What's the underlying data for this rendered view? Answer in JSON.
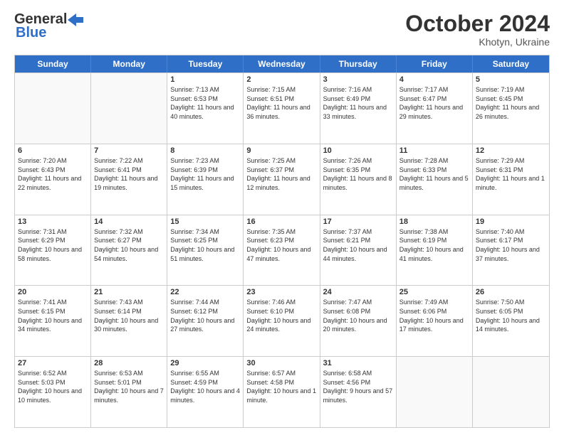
{
  "header": {
    "logo_general": "General",
    "logo_blue": "Blue",
    "month_title": "October 2024",
    "subtitle": "Khotyn, Ukraine"
  },
  "days_of_week": [
    "Sunday",
    "Monday",
    "Tuesday",
    "Wednesday",
    "Thursday",
    "Friday",
    "Saturday"
  ],
  "weeks": [
    [
      {
        "day": "",
        "sunrise": "",
        "sunset": "",
        "daylight": "",
        "empty": true
      },
      {
        "day": "",
        "sunrise": "",
        "sunset": "",
        "daylight": "",
        "empty": true
      },
      {
        "day": "1",
        "sunrise": "Sunrise: 7:13 AM",
        "sunset": "Sunset: 6:53 PM",
        "daylight": "Daylight: 11 hours and 40 minutes.",
        "empty": false
      },
      {
        "day": "2",
        "sunrise": "Sunrise: 7:15 AM",
        "sunset": "Sunset: 6:51 PM",
        "daylight": "Daylight: 11 hours and 36 minutes.",
        "empty": false
      },
      {
        "day": "3",
        "sunrise": "Sunrise: 7:16 AM",
        "sunset": "Sunset: 6:49 PM",
        "daylight": "Daylight: 11 hours and 33 minutes.",
        "empty": false
      },
      {
        "day": "4",
        "sunrise": "Sunrise: 7:17 AM",
        "sunset": "Sunset: 6:47 PM",
        "daylight": "Daylight: 11 hours and 29 minutes.",
        "empty": false
      },
      {
        "day": "5",
        "sunrise": "Sunrise: 7:19 AM",
        "sunset": "Sunset: 6:45 PM",
        "daylight": "Daylight: 11 hours and 26 minutes.",
        "empty": false
      }
    ],
    [
      {
        "day": "6",
        "sunrise": "Sunrise: 7:20 AM",
        "sunset": "Sunset: 6:43 PM",
        "daylight": "Daylight: 11 hours and 22 minutes.",
        "empty": false
      },
      {
        "day": "7",
        "sunrise": "Sunrise: 7:22 AM",
        "sunset": "Sunset: 6:41 PM",
        "daylight": "Daylight: 11 hours and 19 minutes.",
        "empty": false
      },
      {
        "day": "8",
        "sunrise": "Sunrise: 7:23 AM",
        "sunset": "Sunset: 6:39 PM",
        "daylight": "Daylight: 11 hours and 15 minutes.",
        "empty": false
      },
      {
        "day": "9",
        "sunrise": "Sunrise: 7:25 AM",
        "sunset": "Sunset: 6:37 PM",
        "daylight": "Daylight: 11 hours and 12 minutes.",
        "empty": false
      },
      {
        "day": "10",
        "sunrise": "Sunrise: 7:26 AM",
        "sunset": "Sunset: 6:35 PM",
        "daylight": "Daylight: 11 hours and 8 minutes.",
        "empty": false
      },
      {
        "day": "11",
        "sunrise": "Sunrise: 7:28 AM",
        "sunset": "Sunset: 6:33 PM",
        "daylight": "Daylight: 11 hours and 5 minutes.",
        "empty": false
      },
      {
        "day": "12",
        "sunrise": "Sunrise: 7:29 AM",
        "sunset": "Sunset: 6:31 PM",
        "daylight": "Daylight: 11 hours and 1 minute.",
        "empty": false
      }
    ],
    [
      {
        "day": "13",
        "sunrise": "Sunrise: 7:31 AM",
        "sunset": "Sunset: 6:29 PM",
        "daylight": "Daylight: 10 hours and 58 minutes.",
        "empty": false
      },
      {
        "day": "14",
        "sunrise": "Sunrise: 7:32 AM",
        "sunset": "Sunset: 6:27 PM",
        "daylight": "Daylight: 10 hours and 54 minutes.",
        "empty": false
      },
      {
        "day": "15",
        "sunrise": "Sunrise: 7:34 AM",
        "sunset": "Sunset: 6:25 PM",
        "daylight": "Daylight: 10 hours and 51 minutes.",
        "empty": false
      },
      {
        "day": "16",
        "sunrise": "Sunrise: 7:35 AM",
        "sunset": "Sunset: 6:23 PM",
        "daylight": "Daylight: 10 hours and 47 minutes.",
        "empty": false
      },
      {
        "day": "17",
        "sunrise": "Sunrise: 7:37 AM",
        "sunset": "Sunset: 6:21 PM",
        "daylight": "Daylight: 10 hours and 44 minutes.",
        "empty": false
      },
      {
        "day": "18",
        "sunrise": "Sunrise: 7:38 AM",
        "sunset": "Sunset: 6:19 PM",
        "daylight": "Daylight: 10 hours and 41 minutes.",
        "empty": false
      },
      {
        "day": "19",
        "sunrise": "Sunrise: 7:40 AM",
        "sunset": "Sunset: 6:17 PM",
        "daylight": "Daylight: 10 hours and 37 minutes.",
        "empty": false
      }
    ],
    [
      {
        "day": "20",
        "sunrise": "Sunrise: 7:41 AM",
        "sunset": "Sunset: 6:15 PM",
        "daylight": "Daylight: 10 hours and 34 minutes.",
        "empty": false
      },
      {
        "day": "21",
        "sunrise": "Sunrise: 7:43 AM",
        "sunset": "Sunset: 6:14 PM",
        "daylight": "Daylight: 10 hours and 30 minutes.",
        "empty": false
      },
      {
        "day": "22",
        "sunrise": "Sunrise: 7:44 AM",
        "sunset": "Sunset: 6:12 PM",
        "daylight": "Daylight: 10 hours and 27 minutes.",
        "empty": false
      },
      {
        "day": "23",
        "sunrise": "Sunrise: 7:46 AM",
        "sunset": "Sunset: 6:10 PM",
        "daylight": "Daylight: 10 hours and 24 minutes.",
        "empty": false
      },
      {
        "day": "24",
        "sunrise": "Sunrise: 7:47 AM",
        "sunset": "Sunset: 6:08 PM",
        "daylight": "Daylight: 10 hours and 20 minutes.",
        "empty": false
      },
      {
        "day": "25",
        "sunrise": "Sunrise: 7:49 AM",
        "sunset": "Sunset: 6:06 PM",
        "daylight": "Daylight: 10 hours and 17 minutes.",
        "empty": false
      },
      {
        "day": "26",
        "sunrise": "Sunrise: 7:50 AM",
        "sunset": "Sunset: 6:05 PM",
        "daylight": "Daylight: 10 hours and 14 minutes.",
        "empty": false
      }
    ],
    [
      {
        "day": "27",
        "sunrise": "Sunrise: 6:52 AM",
        "sunset": "Sunset: 5:03 PM",
        "daylight": "Daylight: 10 hours and 10 minutes.",
        "empty": false
      },
      {
        "day": "28",
        "sunrise": "Sunrise: 6:53 AM",
        "sunset": "Sunset: 5:01 PM",
        "daylight": "Daylight: 10 hours and 7 minutes.",
        "empty": false
      },
      {
        "day": "29",
        "sunrise": "Sunrise: 6:55 AM",
        "sunset": "Sunset: 4:59 PM",
        "daylight": "Daylight: 10 hours and 4 minutes.",
        "empty": false
      },
      {
        "day": "30",
        "sunrise": "Sunrise: 6:57 AM",
        "sunset": "Sunset: 4:58 PM",
        "daylight": "Daylight: 10 hours and 1 minute.",
        "empty": false
      },
      {
        "day": "31",
        "sunrise": "Sunrise: 6:58 AM",
        "sunset": "Sunset: 4:56 PM",
        "daylight": "Daylight: 9 hours and 57 minutes.",
        "empty": false
      },
      {
        "day": "",
        "sunrise": "",
        "sunset": "",
        "daylight": "",
        "empty": true
      },
      {
        "day": "",
        "sunrise": "",
        "sunset": "",
        "daylight": "",
        "empty": true
      }
    ]
  ]
}
